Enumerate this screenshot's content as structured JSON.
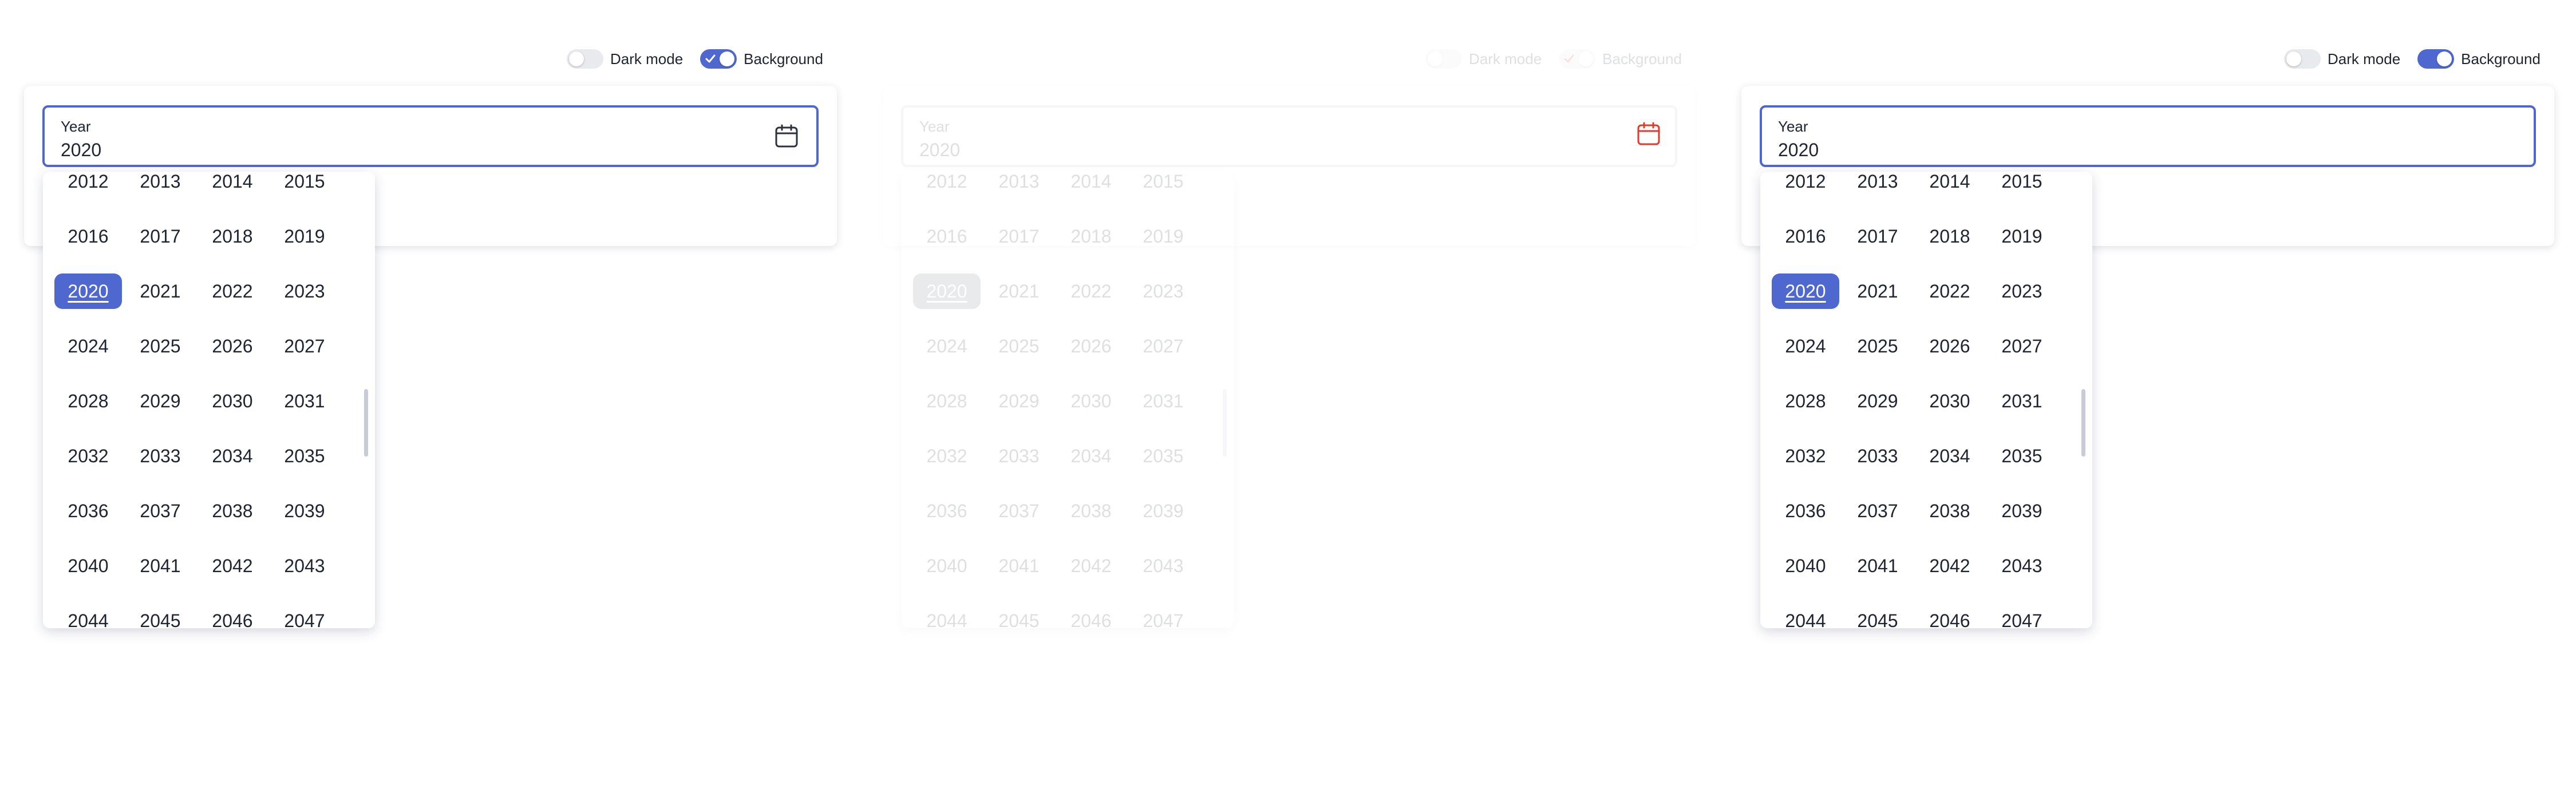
{
  "panels": [
    {
      "toggles": {
        "dark_mode_label": "Dark mode",
        "dark_mode_on": false,
        "background_label": "Background",
        "background_on": true
      },
      "field": {
        "label": "Year",
        "value": "2020"
      },
      "selected_year": "2020"
    },
    {
      "toggles": {
        "dark_mode_label": "Dark mode",
        "dark_mode_on": false,
        "background_label": "Background",
        "background_on": true
      },
      "field": {
        "label": "Year",
        "value": "2020"
      },
      "selected_year": "2020"
    },
    {
      "toggles": {
        "dark_mode_label": "Dark mode",
        "dark_mode_on": false,
        "background_label": "Background",
        "background_on": true
      },
      "field": {
        "label": "Year",
        "value": "2020"
      },
      "selected_year": "2020"
    }
  ],
  "years": [
    "2012",
    "2013",
    "2014",
    "2015",
    "2016",
    "2017",
    "2018",
    "2019",
    "2020",
    "2021",
    "2022",
    "2023",
    "2024",
    "2025",
    "2026",
    "2027",
    "2028",
    "2029",
    "2030",
    "2031",
    "2032",
    "2033",
    "2034",
    "2035",
    "2036",
    "2037",
    "2038",
    "2039",
    "2040",
    "2041",
    "2042",
    "2043",
    "2044",
    "2045",
    "2046",
    "2047"
  ],
  "colors": {
    "accent": "#4f68d0",
    "error_icon": "#e03a2f",
    "toggle_off": "#e9eaee",
    "text": "#1f2433"
  },
  "icons": {
    "field_icon": "calendar-icon",
    "toggle_check": "check-icon"
  }
}
